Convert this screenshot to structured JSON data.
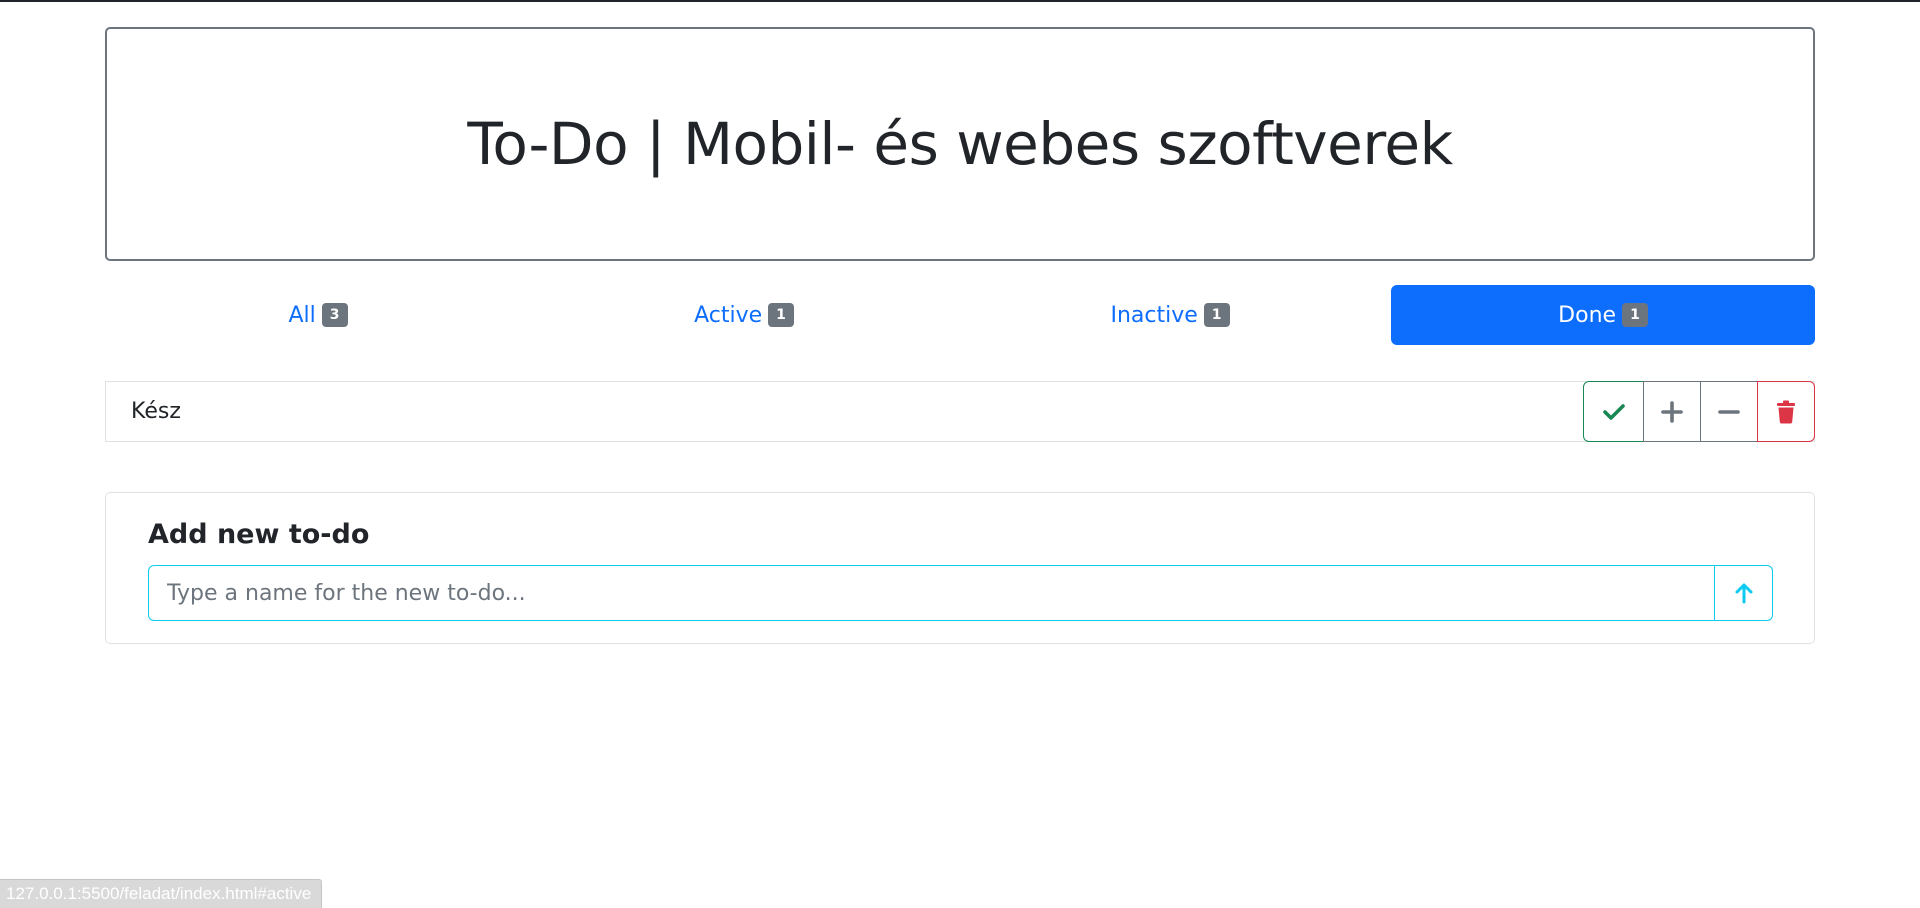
{
  "header": {
    "title": "To-Do | Mobil- és webes szoftverek"
  },
  "tabs": [
    {
      "label": "All",
      "count": "3",
      "active": false
    },
    {
      "label": "Active",
      "count": "1",
      "active": false
    },
    {
      "label": "Inactive",
      "count": "1",
      "active": false
    },
    {
      "label": "Done",
      "count": "1",
      "active": true
    }
  ],
  "todos": [
    {
      "name": "Kész",
      "actions": [
        "check-icon",
        "plus-icon",
        "minus-icon",
        "trash-icon"
      ]
    }
  ],
  "add_form": {
    "title": "Add new to-do",
    "placeholder": "Type a name for the new to-do...",
    "submit_icon": "arrow-up-icon"
  },
  "status_bar": {
    "url": "127.0.0.1:5500/feladat/index.html#active"
  },
  "colors": {
    "primary": "#0d6efd",
    "success": "#198754",
    "secondary": "#6c757d",
    "danger": "#dc3545",
    "info": "#0dcaf0"
  }
}
